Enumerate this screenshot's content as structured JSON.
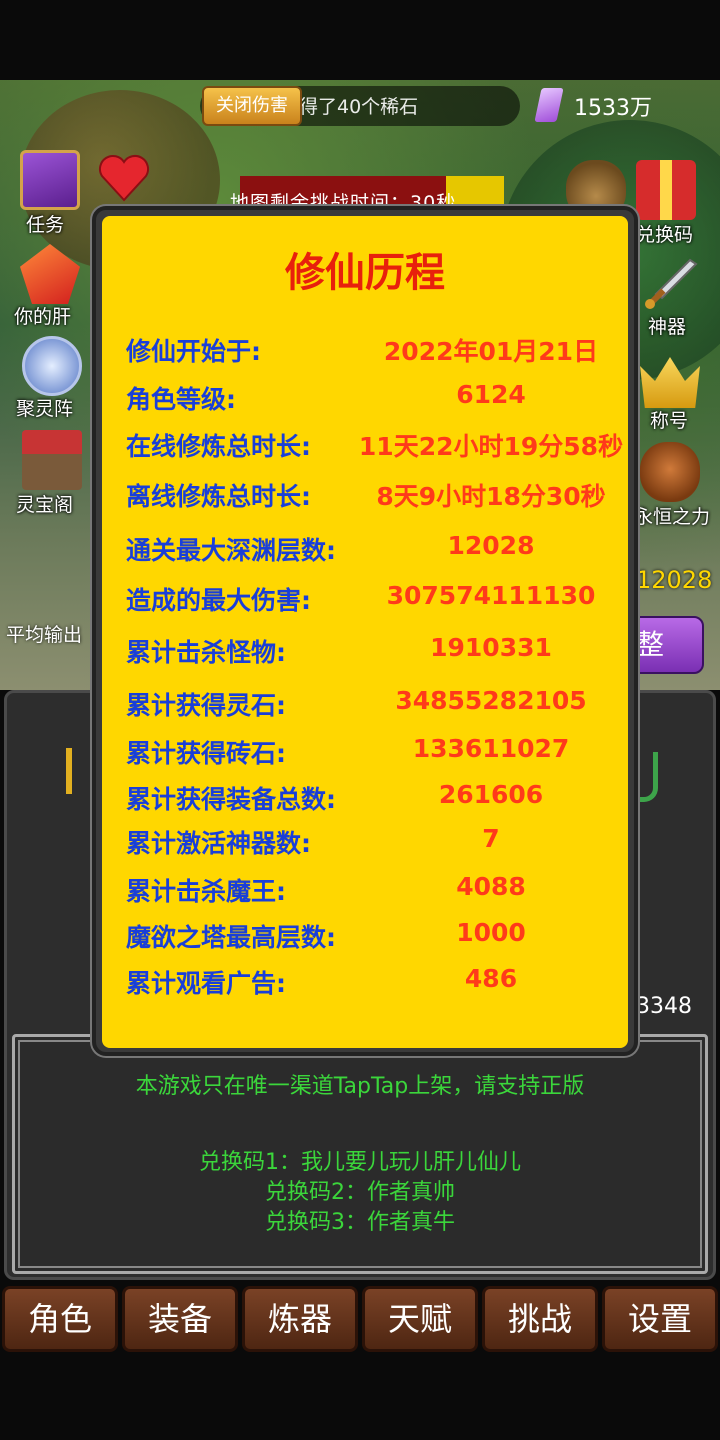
{
  "header": {
    "close_label": "关闭伤害",
    "message": "获得了40个稀石",
    "gem_count": "1533万",
    "timer_text": "地图剩余挑战时间：30秒",
    "timer_fraction": 0.78
  },
  "side_menu": {
    "left": [
      {
        "label": "任务",
        "icon": "quest-book-icon"
      },
      {
        "label": "你的肝",
        "icon": "red-gem-icon"
      },
      {
        "label": "聚灵阵",
        "icon": "spirit-array-icon"
      },
      {
        "label": "灵宝阁",
        "icon": "shop-icon"
      }
    ],
    "right": [
      {
        "label": "兑换码",
        "icon": "gift-box-icon"
      },
      {
        "label": "神器",
        "icon": "sword-icon"
      },
      {
        "label": "称号",
        "icon": "crown-icon"
      },
      {
        "label": "永恒之力",
        "icon": "skull-icon"
      }
    ]
  },
  "stage": {
    "abyss_level": "12028",
    "avg_output_label": "平均输出",
    "adjust_label": "整",
    "right_number": "3348"
  },
  "modal": {
    "title": "修仙历程",
    "rows": [
      {
        "label": "修仙开始于:",
        "value": "2022年01月21日"
      },
      {
        "label": "角色等级:",
        "value": "6124"
      },
      {
        "label": "在线修炼总时长:",
        "value": "11天22小时19分58秒"
      },
      {
        "label": "离线修炼总时长:",
        "value": "8天9小时18分30秒"
      },
      {
        "label": "通关最大深渊层数:",
        "value": "12028"
      },
      {
        "label": "造成的最大伤害:",
        "value": "307574111130"
      },
      {
        "label": "累计击杀怪物:",
        "value": "1910331"
      },
      {
        "label": "累计获得灵石:",
        "value": "34855282105"
      },
      {
        "label": "累计获得砖石:",
        "value": "133611027"
      },
      {
        "label": "累计获得装备总数:",
        "value": "261606"
      },
      {
        "label": "累计激活神器数:",
        "value": "7"
      },
      {
        "label": "累计击杀魔王:",
        "value": "4088"
      },
      {
        "label": "魔欲之塔最高层数:",
        "value": "1000"
      },
      {
        "label": "累计观看广告:",
        "value": "486"
      }
    ]
  },
  "notice": {
    "main": "本游戏只在唯一渠道TapTap上架，请支持正版",
    "code1": "兑换码1：我儿要儿玩儿肝儿仙儿",
    "code2": "兑换码2：作者真帅",
    "code3": "兑换码3：作者真牛"
  },
  "bottom_nav": [
    "角色",
    "装备",
    "炼器",
    "天赋",
    "挑战",
    "设置"
  ],
  "colors": {
    "modal_bg": "#ffd700",
    "title": "#e8200c",
    "label": "#1a3fd8",
    "value": "#ff3a1a",
    "notice": "#3bd63b"
  }
}
